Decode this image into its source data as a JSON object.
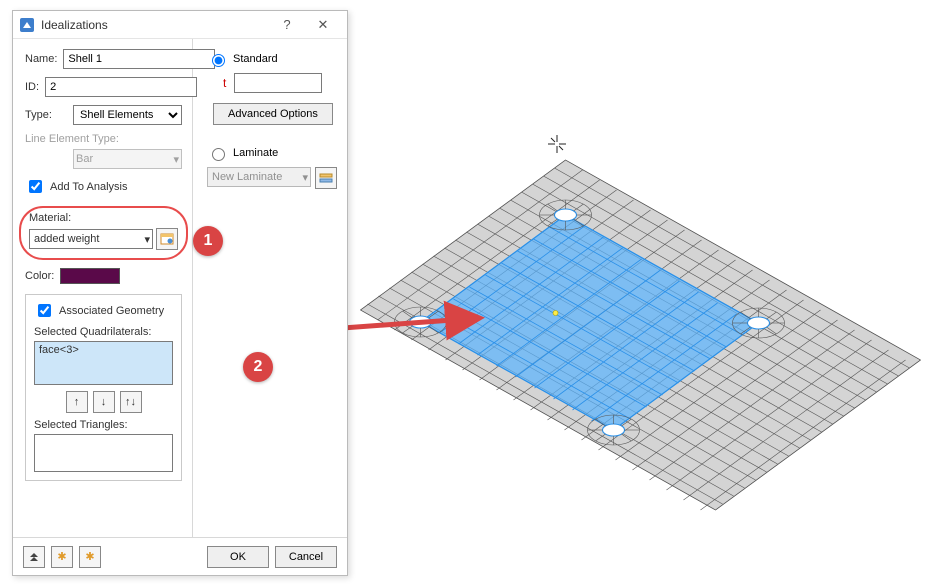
{
  "dialog": {
    "title": "Idealizations",
    "name_label": "Name:",
    "name_value": "Shell 1",
    "id_label": "ID:",
    "id_value": "2",
    "type_label": "Type:",
    "type_value": "Shell Elements",
    "line_elem_label": "Line Element Type:",
    "line_elem_value": "Bar",
    "add_to_analysis": "Add To Analysis",
    "material_label": "Material:",
    "material_value": "added weight",
    "color_label": "Color:",
    "color_hex": "#5a0949",
    "assoc_geom_label": "Associated Geometry",
    "selected_quads_label": "Selected Quadrilaterals:",
    "selected_quads_value": "face<3>",
    "selected_tris_label": "Selected Triangles:",
    "standard_label": "Standard",
    "t_label": "t",
    "adv_opts": "Advanced Options",
    "laminate_label": "Laminate",
    "new_laminate": "New Laminate",
    "ok": "OK",
    "cancel": "Cancel"
  },
  "callouts": {
    "one": "1",
    "two": "2"
  }
}
